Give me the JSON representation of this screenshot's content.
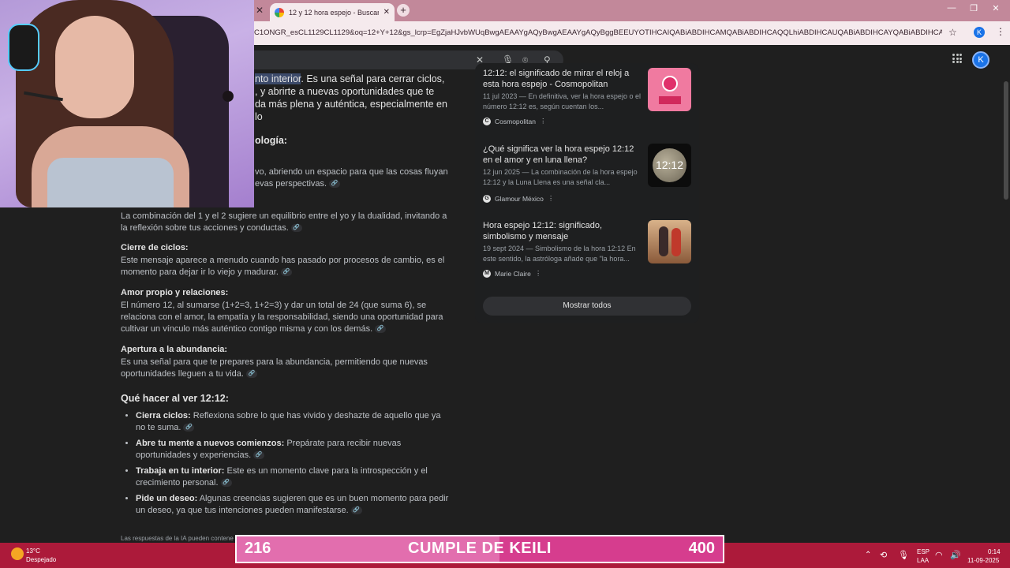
{
  "browser": {
    "tab_title": "12 y 12 hora espejo - Buscar co",
    "url": "C1ONGR_esCL1129CL1129&oq=12+Y+12&gs_lcrp=EgZjaHJvbWUqBwgAEAAYgAQyBwgAEAAYgAQyBggBEEUYOTIHCAIQABiABDIHCAMQABiABDIHCAQQLhiABDIHCAUQABiABDIHCAYQABiABDIHCAcQABiABDIH...",
    "profile_initial": "K"
  },
  "header": {
    "avatar_initial": "K"
  },
  "content": {
    "intro_highlight": "nto interior",
    "intro_rest_1": ". Es una señal para cerrar ciclos,",
    "intro_line_2": ", y abrirte a nuevas oportunidades que te",
    "intro_line_3": "da más plena y auténtica, especialmente en lo",
    "numerology_heading": "ología:",
    "numerology_line_1": "vo, abriendo un espacio para que las cosas fluyan",
    "numerology_line_2": "evas perspectivas.",
    "combination_text": "La combinación del 1 y el 2 sugiere un equilibrio entre el yo y la dualidad, invitando a la reflexión sobre tus acciones y conductas.",
    "sections": [
      {
        "title": "Cierre de ciclos:",
        "text": "Este mensaje aparece a menudo cuando has pasado por procesos de cambio, es el momento para dejar ir lo viejo y madurar."
      },
      {
        "title": "Amor propio y relaciones:",
        "text": "El número 12, al sumarse (1+2=3, 1+2=3) y dar un total de 24 (que suma 6), se relaciona con el amor, la empatía y la responsabilidad, siendo una oportunidad para cultivar un vínculo más auténtico contigo misma y con los demás."
      },
      {
        "title": "Apertura a la abundancia:",
        "text": "Es una señal para que te prepares para la abundancia, permitiendo que nuevas oportunidades lleguen a tu vida."
      }
    ],
    "what_to_do_heading": "Qué hacer al ver 12:12:",
    "bullets": [
      {
        "bold": "Cierra ciclos:",
        "text": " Reflexiona sobre lo que has vivido y deshazte de aquello que ya no te suma."
      },
      {
        "bold": "Abre tu mente a nuevos comienzos:",
        "text": " Prepárate para recibir nuevas oportunidades y experiencias."
      },
      {
        "bold": "Trabaja en tu interior:",
        "text": " Este es un momento clave para la introspección y el crecimiento personal."
      },
      {
        "bold": "Pide un deseo:",
        "text": " Algunas creencias sugieren que es un buen momento para pedir un deseo, ya que tus intenciones pueden manifestarse."
      }
    ],
    "disclaimer": "Las respuestas de la IA pueden contene"
  },
  "sources": {
    "cards": [
      {
        "title": "12:12: el significado de mirar el reloj a esta hora espejo - Cosmopolitan",
        "snippet": "11 jul 2023 — En definitiva, ver la hora espejo o el número 12:12 es, según cuentan los...",
        "source": "Cosmopolitan",
        "logo": "C"
      },
      {
        "title": "¿Qué significa ver la hora espejo 12:12 en el amor y en luna llena?",
        "snippet": "12 jun 2025 — La combinación de la hora espejo 12:12 y la Luna Llena es una señal cla...",
        "source": "Glamour México",
        "logo": "G",
        "thumb_text": "12:12"
      },
      {
        "title": "Hora espejo 12:12: significado, simbolismo y mensaje",
        "snippet": "19 sept 2024 — Simbolismo de la hora 12:12 En este sentido, la astróloga añade que \"la hora...",
        "source": "Marie Claire",
        "logo": "M"
      }
    ],
    "show_all_label": "Mostrar todos"
  },
  "taskbar": {
    "weather_temp": "13°C",
    "weather_desc": "Despejado",
    "lang_1": "ESP",
    "lang_2": "LAA",
    "time": "0:14",
    "date": "11-09-2025"
  },
  "goal": {
    "start": "216",
    "title": "CUMPLE DE KEILI",
    "end": "400",
    "progress": 0.54
  },
  "colors": {
    "taskbar": "#ac1a3a",
    "goal_bar": "#d63d8e",
    "titlebar": "#c2889a"
  }
}
